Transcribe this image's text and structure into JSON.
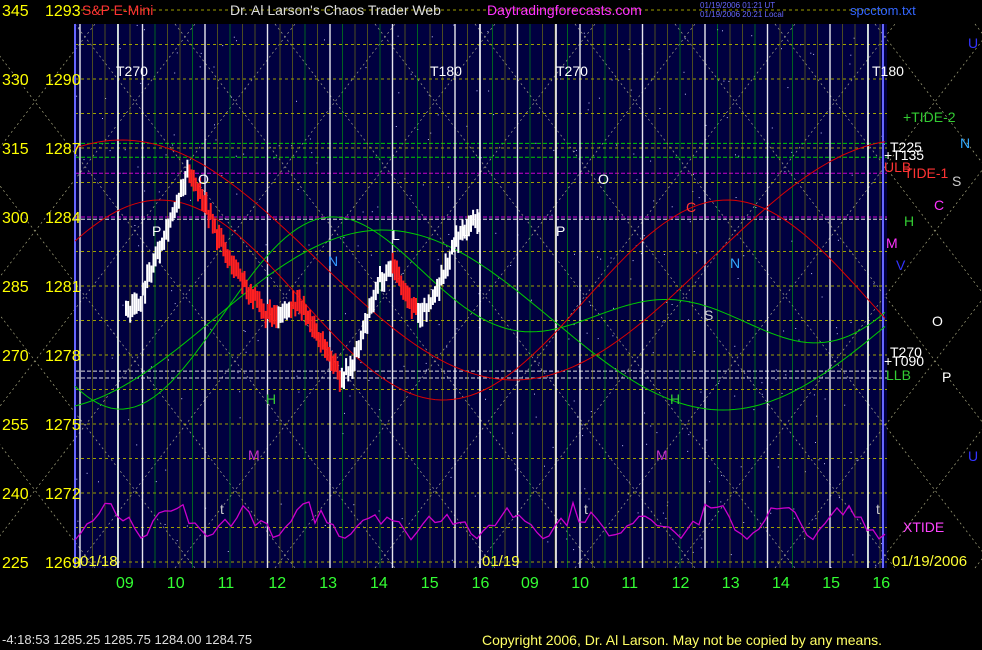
{
  "header": {
    "symbol": "S&P E-Mini",
    "author": "Dr. Al Larson's Chaos Trader Web",
    "site": "Daytradingforecasts.com",
    "stamp1": "01/19/2006 01:21 UT",
    "stamp2": "01/19/2006 20:21 Local",
    "file": "spcctom.txt"
  },
  "footer": {
    "quote": "-4:18:53  1285.25 1285.75 1284.00 1284.75",
    "copyright": "Copyright 2006, Dr. Al Larson. May not be copied by any means."
  },
  "colors": {
    "background": "#000040",
    "axis_text": "#ffff00",
    "grid": "#a0a000",
    "time_lines": "#ffffff",
    "green_line": "#00cc00",
    "red_line": "#dd0000",
    "magenta_line": "#cc00cc",
    "price_bar": "#ffffff",
    "price_bar_down": "#ff2020"
  },
  "chart_data": {
    "type": "line",
    "title": "",
    "left_axis_label": "",
    "y_left_ticks": [
      345,
      330,
      315,
      300,
      285,
      270,
      255,
      240,
      225
    ],
    "y_price_ticks": [
      "1293",
      "1290",
      "1287",
      "1284",
      "1281",
      "1278",
      "1275",
      "1272",
      "1269"
    ],
    "ylim_price": [
      1269,
      1293
    ],
    "x_tick_labels": [
      "09",
      "10",
      "11",
      "12",
      "13",
      "14",
      "15",
      "16",
      "09",
      "10",
      "11",
      "12",
      "13",
      "14",
      "15",
      "16"
    ],
    "date_labels": [
      "01/18",
      "01/19",
      "01/19/2006"
    ],
    "hours": [
      9,
      10,
      11,
      12,
      13,
      14,
      15,
      16
    ],
    "angle_labels_top": [
      "T270",
      "T180",
      "T270",
      "T180"
    ],
    "right_labels": [
      "+TIDE-2",
      "T225",
      "+T135",
      "ULB",
      "TIDE-1",
      "T270",
      "+T090",
      "LLB",
      "XTIDE"
    ],
    "planet_letters": [
      "U",
      "N",
      "S",
      "C",
      "H",
      "M",
      "V",
      "O",
      "P",
      "U"
    ],
    "chart_letters": [
      "O",
      "P",
      "N",
      "L",
      "L",
      "O",
      "P",
      "N",
      "C",
      "S",
      "H",
      "M",
      "H",
      "M",
      "t",
      "t",
      "t"
    ],
    "series": [
      {
        "name": "S&P E-Mini",
        "x_hours": [
          9.0,
          9.25,
          9.5,
          9.75,
          10.0,
          10.25,
          10.5,
          10.75,
          11.0,
          11.25,
          11.5,
          11.75,
          12.0,
          12.25,
          12.5,
          12.75,
          13.0,
          13.25,
          13.5,
          13.75,
          14.0,
          14.25,
          14.5,
          14.75,
          15.0,
          15.25,
          15.5,
          15.75,
          16.0
        ],
        "values": [
          1280.0,
          1280.25,
          1281.75,
          1283.25,
          1284.5,
          1286.0,
          1285.0,
          1283.5,
          1282.25,
          1281.5,
          1280.5,
          1279.75,
          1279.5,
          1280.25,
          1280.0,
          1279.0,
          1278.0,
          1277.0,
          1277.75,
          1279.5,
          1281.25,
          1282.0,
          1280.75,
          1279.75,
          1280.25,
          1281.5,
          1283.0,
          1283.75,
          1284.0
        ]
      }
    ]
  }
}
